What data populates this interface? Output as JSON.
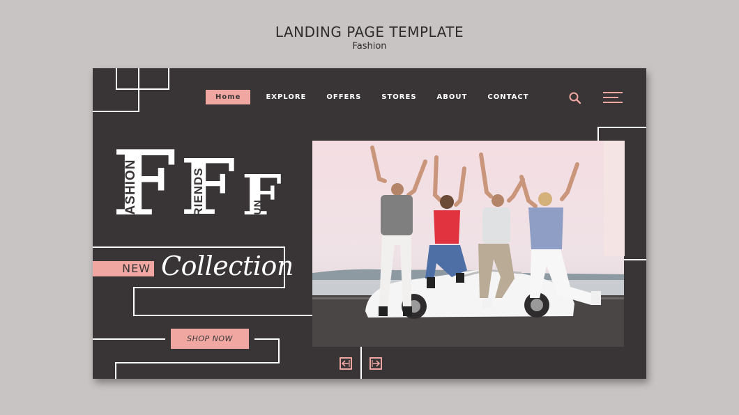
{
  "header": {
    "title": "LANDING PAGE TEMPLATE",
    "subtitle": "Fashion"
  },
  "nav": {
    "items": [
      {
        "label": "Home",
        "active": true
      },
      {
        "label": "Explore"
      },
      {
        "label": "Offers"
      },
      {
        "label": "Stores"
      },
      {
        "label": "About"
      },
      {
        "label": "Contact"
      }
    ],
    "icons": [
      "search-icon",
      "hamburger-menu-icon"
    ]
  },
  "hero": {
    "words": [
      "FASHION",
      "FRIENDS",
      "FUN"
    ],
    "letter": "F",
    "new_label": "NEW",
    "collection_label": "Collection",
    "cta_label": "SHOP NOW"
  },
  "colors": {
    "background": "#393536",
    "accent": "#f0a7a2",
    "page": "#c8c4c3",
    "line": "#ffffff"
  },
  "carousel": {
    "prev_icon": "arrow-left-icon",
    "next_icon": "arrow-right-icon"
  }
}
